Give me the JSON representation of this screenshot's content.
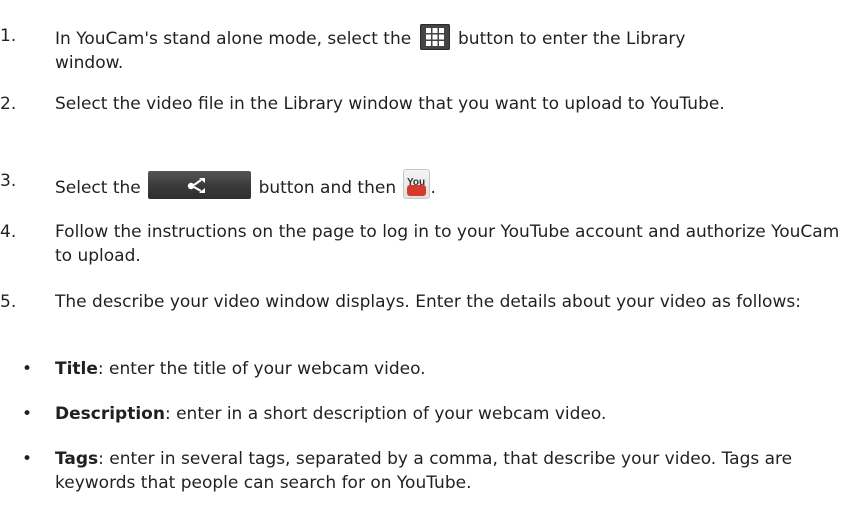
{
  "steps": [
    {
      "num": "1.",
      "parts": [
        "In YouCam's stand alone mode, select the",
        "button to enter the Library",
        "window."
      ]
    },
    {
      "num": "2.",
      "text": "Select the video file in the Library window that you want to upload to YouTube."
    },
    {
      "num": "3.",
      "parts": [
        "Select the",
        "button and then",
        "."
      ]
    },
    {
      "num": "4.",
      "text": "Follow the instructions on the page to log in to your YouTube account and authorize YouCam to upload."
    },
    {
      "num": "5.",
      "text": "The describe your video window displays. Enter the details about your video as follows:"
    }
  ],
  "bullets": [
    {
      "term": "Title",
      "text": ": enter the title of your webcam video."
    },
    {
      "term": "Description",
      "text": ": enter in a short description of your webcam video."
    },
    {
      "term": "Tags",
      "text": ": enter in several tags, separated by a comma, that describe your video. Tags are keywords that people can search for on YouTube."
    }
  ],
  "bullet_char": "•",
  "icons": {
    "library": "library-grid-icon",
    "share": "share-icon",
    "youtube": "youtube-icon",
    "youtube_label": "You",
    "youtube_color": "#d43b2c"
  }
}
